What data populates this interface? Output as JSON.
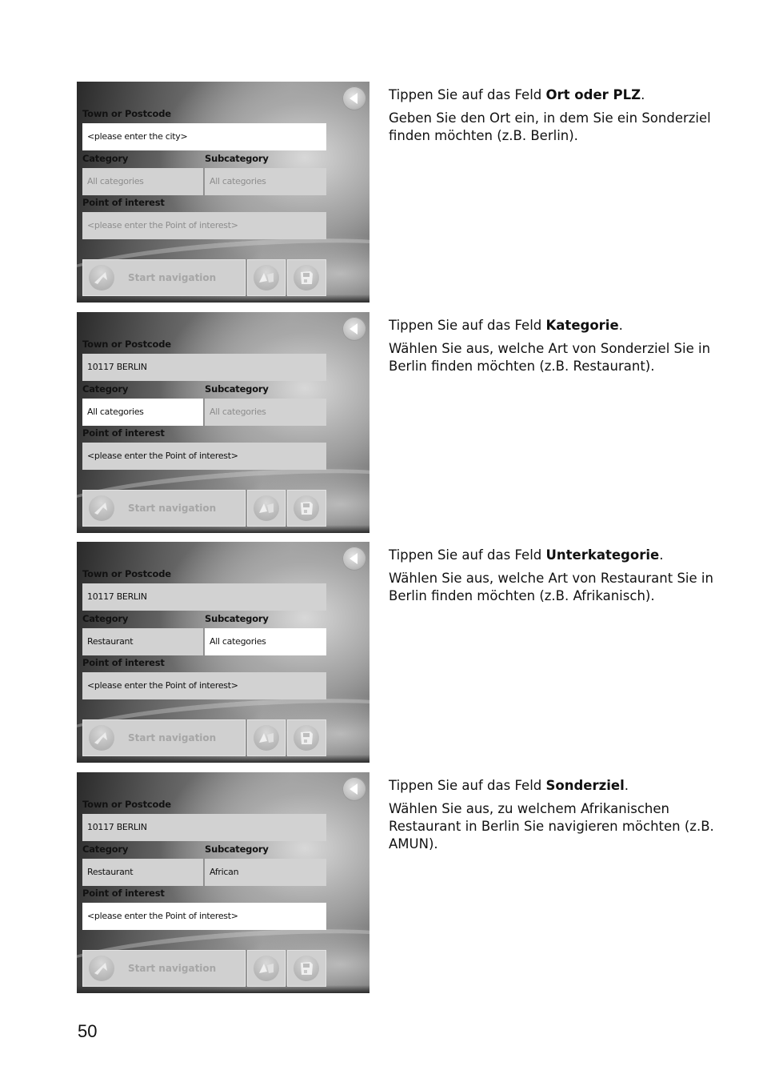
{
  "page": {
    "number": "50"
  },
  "labels": {
    "town": "Town or Postcode",
    "category": "Category",
    "subcategory": "Subcategory",
    "poi": "Point of interest",
    "start_navigation": "Start navigation"
  },
  "icons": {
    "back": "back-arrow-icon",
    "start_navigation": "navigation-arrow-icon",
    "map": "map-icon",
    "save": "floppy-disk-icon"
  },
  "steps": [
    {
      "fields": {
        "town": "<please enter the city>",
        "category": "All categories",
        "subcategory": "All categories",
        "poi": "<please enter the Point of interest>"
      },
      "active_field": "town",
      "dimmed_fields": [
        "category",
        "subcategory",
        "poi"
      ],
      "instruction_prefix": "Tippen Sie auf das Feld ",
      "instruction_field": "Ort oder PLZ",
      "instruction_suffix": ".",
      "explanation": "Geben Sie den Ort ein, in dem Sie ein Sonderziel finden möchten (z.B. Berlin)."
    },
    {
      "fields": {
        "town": "10117 BERLIN",
        "category": "All categories",
        "subcategory": "All categories",
        "poi": "<please enter the Point of interest>"
      },
      "active_field": "category",
      "dimmed_fields": [
        "subcategory"
      ],
      "instruction_prefix": "Tippen Sie auf das Feld ",
      "instruction_field": "Kategorie",
      "instruction_suffix": ".",
      "explanation": "Wählen Sie aus, welche Art von Sonderziel Sie in Berlin finden möchten (z.B. Restaurant)."
    },
    {
      "fields": {
        "town": "10117 BERLIN",
        "category": "Restaurant",
        "subcategory": "All categories",
        "poi": "<please enter the Point of interest>"
      },
      "active_field": "subcategory",
      "dimmed_fields": [],
      "instruction_prefix": "Tippen Sie auf das Feld ",
      "instruction_field": "Unterkategorie",
      "instruction_suffix": ".",
      "explanation": "Wählen Sie aus, welche Art von Restaurant Sie in Berlin finden möchten (z.B. Afrikanisch)."
    },
    {
      "fields": {
        "town": "10117 BERLIN",
        "category": "Restaurant",
        "subcategory": "African",
        "poi": "<please enter the Point of interest>"
      },
      "active_field": "poi",
      "dimmed_fields": [],
      "instruction_prefix": "Tippen Sie auf das Feld ",
      "instruction_field": "Sonderziel",
      "instruction_suffix": ".",
      "explanation": "Wählen Sie aus, zu welchem Afrikanischen Restaurant in Berlin Sie navigieren möchten (z.B. AMUN)."
    }
  ]
}
